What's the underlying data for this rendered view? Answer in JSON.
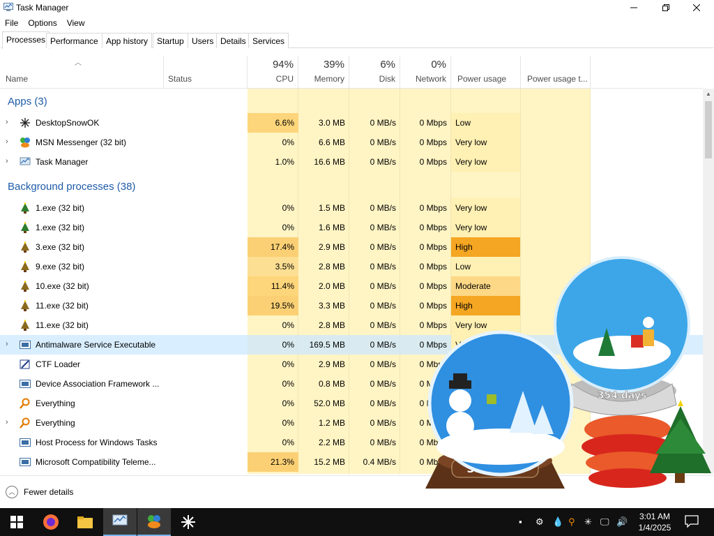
{
  "window": {
    "title": "Task Manager"
  },
  "menu": [
    "File",
    "Options",
    "View"
  ],
  "tabs": [
    "Processes",
    "Performance",
    "App history",
    "Startup",
    "Users",
    "Details",
    "Services"
  ],
  "columns": {
    "name": "Name",
    "status": "Status",
    "cpu": {
      "pct": "94%",
      "label": "CPU"
    },
    "memory": {
      "pct": "39%",
      "label": "Memory"
    },
    "disk": {
      "pct": "6%",
      "label": "Disk"
    },
    "network": {
      "pct": "0%",
      "label": "Network"
    },
    "power": "Power usage",
    "power_trend": "Power usage t..."
  },
  "groups": {
    "apps": "Apps (3)",
    "background": "Background processes (38)"
  },
  "apps": [
    {
      "name": "DesktopSnowOK",
      "cpu": "6.6%",
      "mem": "3.0 MB",
      "disk": "0 MB/s",
      "net": "0 Mbps",
      "power": "Low"
    },
    {
      "name": "MSN Messenger (32 bit)",
      "cpu": "0%",
      "mem": "6.6 MB",
      "disk": "0 MB/s",
      "net": "0 Mbps",
      "power": "Very low"
    },
    {
      "name": "Task Manager",
      "cpu": "1.0%",
      "mem": "16.6 MB",
      "disk": "0 MB/s",
      "net": "0 Mbps",
      "power": "Very low"
    }
  ],
  "background": [
    {
      "name": "1.exe (32 bit)",
      "cpu": "0%",
      "mem": "1.5 MB",
      "disk": "0 MB/s",
      "net": "0 Mbps",
      "power": "Very low"
    },
    {
      "name": "1.exe (32 bit)",
      "cpu": "0%",
      "mem": "1.6 MB",
      "disk": "0 MB/s",
      "net": "0 Mbps",
      "power": "Very low"
    },
    {
      "name": "3.exe (32 bit)",
      "cpu": "17.4%",
      "mem": "2.9 MB",
      "disk": "0 MB/s",
      "net": "0 Mbps",
      "power": "High"
    },
    {
      "name": "9.exe (32 bit)",
      "cpu": "3.5%",
      "mem": "2.8 MB",
      "disk": "0 MB/s",
      "net": "0 Mbps",
      "power": "Low"
    },
    {
      "name": "10.exe (32 bit)",
      "cpu": "11.4%",
      "mem": "2.0 MB",
      "disk": "0 MB/s",
      "net": "0 Mbps",
      "power": "Moderate"
    },
    {
      "name": "11.exe (32 bit)",
      "cpu": "19.5%",
      "mem": "3.3 MB",
      "disk": "0 MB/s",
      "net": "0 Mbps",
      "power": "High"
    },
    {
      "name": "11.exe (32 bit)",
      "cpu": "0%",
      "mem": "2.8 MB",
      "disk": "0 MB/s",
      "net": "0 Mbps",
      "power": "Very low"
    },
    {
      "name": "Antimalware Service Executable",
      "cpu": "0%",
      "mem": "169.5 MB",
      "disk": "0 MB/s",
      "net": "0 Mbps",
      "power": "Very low"
    },
    {
      "name": "CTF Loader",
      "cpu": "0%",
      "mem": "2.9 MB",
      "disk": "0 MB/s",
      "net": "0 Mbps",
      "power": ""
    },
    {
      "name": "Device Association Framework ...",
      "cpu": "0%",
      "mem": "0.8 MB",
      "disk": "0 MB/s",
      "net": "0 Mbps",
      "power": ""
    },
    {
      "name": "Everything",
      "cpu": "0%",
      "mem": "52.0 MB",
      "disk": "0 MB/s",
      "net": "0 Mbps",
      "power": ""
    },
    {
      "name": "Everything",
      "cpu": "0%",
      "mem": "1.2 MB",
      "disk": "0 MB/s",
      "net": "0 Mbps",
      "power": ""
    },
    {
      "name": "Host Process for Windows Tasks",
      "cpu": "0%",
      "mem": "2.2 MB",
      "disk": "0 MB/s",
      "net": "0 Mbps",
      "power": ""
    },
    {
      "name": "Microsoft Compatibility Teleme...",
      "cpu": "21.3%",
      "mem": "15.2 MB",
      "disk": "0.4 MB/s",
      "net": "0 Mbps",
      "power": ""
    }
  ],
  "footer": {
    "fewer_details": "Fewer details"
  },
  "overlay": {
    "globe_days": "354 days"
  },
  "clock": {
    "time": "3:01 AM",
    "date": "1/4/2025"
  },
  "colors": {
    "accent": "#1e5ba8",
    "heat_light": "#fff4c4",
    "heat_high": "#f5a623",
    "heat_moderate": "#fdd886",
    "selection": "#cce8ff"
  }
}
